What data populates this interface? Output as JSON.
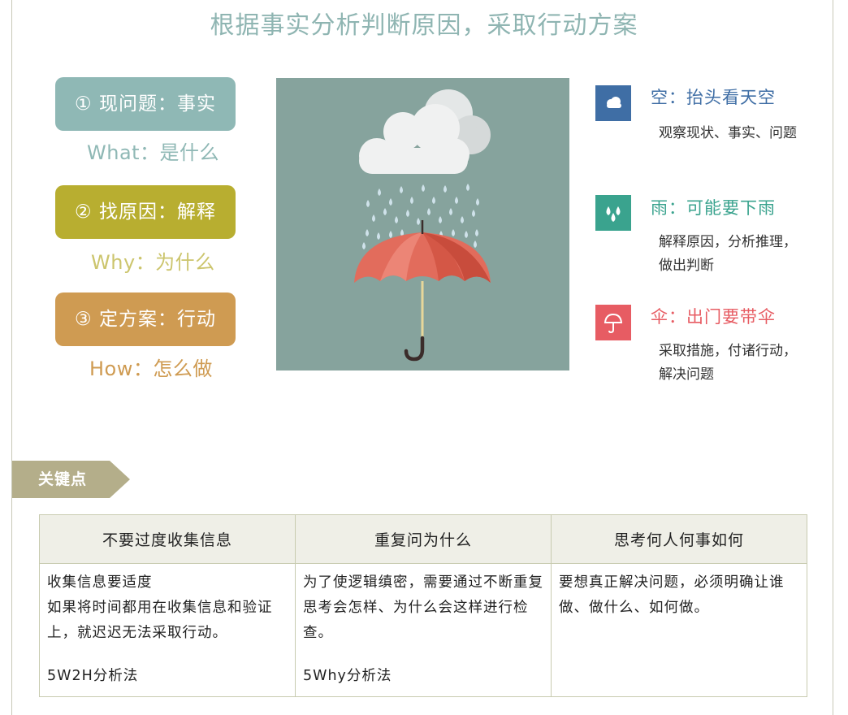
{
  "title": "根据事实分析判断原因，采取行动方案",
  "steps": [
    {
      "label": "① 现问题：事实",
      "sub": "What：是什么",
      "color": "#8fb8b5",
      "sub_color": "#8fb8b5"
    },
    {
      "label": "② 找原因：解释",
      "sub": "Why：为什么",
      "color": "#b8ae30",
      "sub_color": "#ccc56d"
    },
    {
      "label": "③ 定方案：行动",
      "sub": "How：怎么做",
      "color": "#cf9b52",
      "sub_color": "#cf9b52"
    }
  ],
  "legend": [
    {
      "icon": "cloud-icon",
      "title": "空：抬头看天空",
      "desc": "观察现状、事实、问题",
      "color": "#3f6ea5"
    },
    {
      "icon": "raindrops-icon",
      "title": "雨：可能要下雨",
      "desc": "解释原因，分析推理，做出判断",
      "color": "#3aa38e"
    },
    {
      "icon": "umbrella-icon",
      "title": "伞：出门要带伞",
      "desc": "采取措施，付诸行动，解决问题",
      "color": "#e75c63"
    }
  ],
  "section_tag": "关键点",
  "table": {
    "headers": [
      "不要过度收集信息",
      "重复问为什么",
      "思考何人何事如何"
    ],
    "cells": [
      {
        "text": "收集信息要适度\n如果将时间都用在收集信息和验证上，就迟迟无法采取行动。",
        "method": "5W2H分析法"
      },
      {
        "text": "为了使逻辑缜密，需要通过不断重复思考会怎样、为什么会这样进行检查。",
        "method": "5Why分析法"
      },
      {
        "text": "要想真正解决问题，必须明确让谁做、做什么、如何做。",
        "method": ""
      }
    ]
  }
}
